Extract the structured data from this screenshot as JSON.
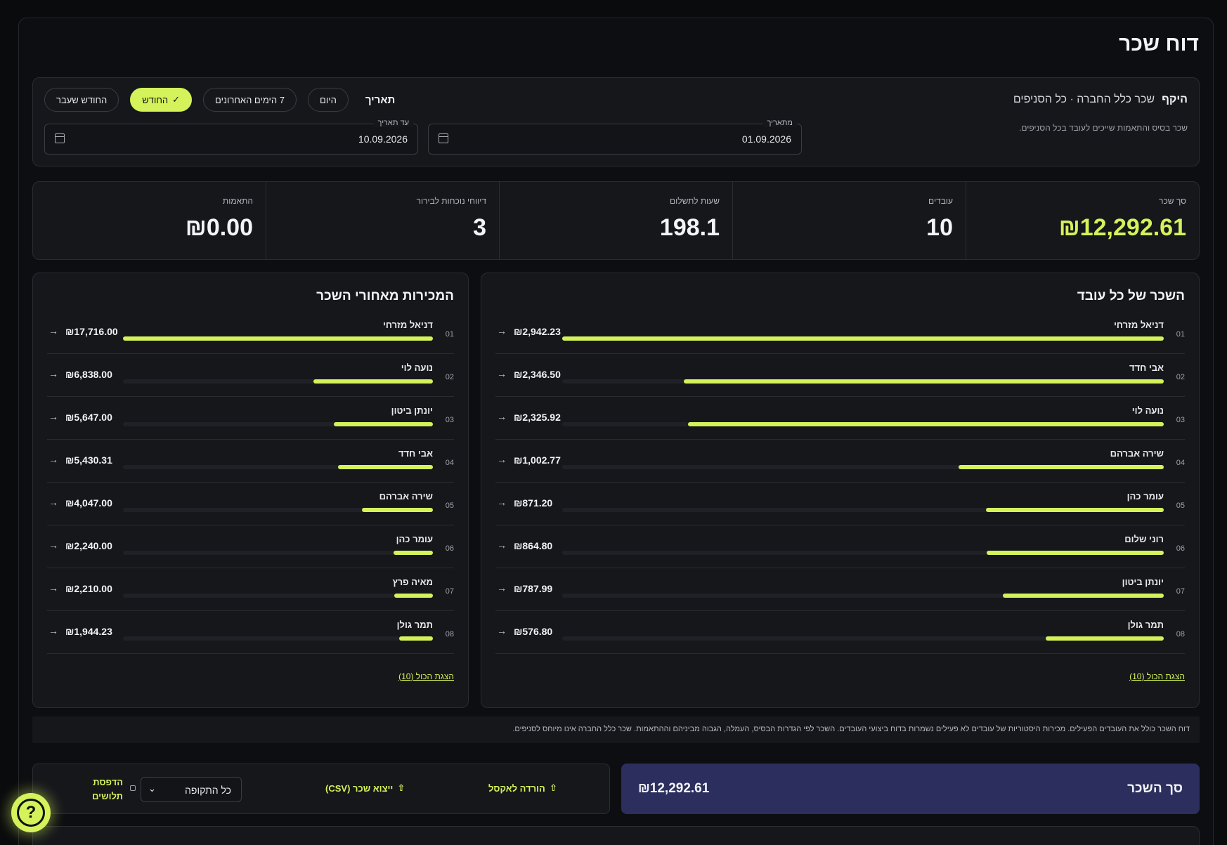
{
  "page": {
    "title": "דוח שכר"
  },
  "filter": {
    "scope_label": "היקף",
    "scope_value": "שכר כלל החברה · כל הסניפים",
    "scope_desc": "שכר בסיס והתאמות שייכים לעובד בכל הסניפים.",
    "date_label": "תאריך",
    "presets": {
      "today": "היום",
      "last7": "7 הימים האחרונים",
      "this_month": "החודש",
      "last_month": "החודש שעבר"
    },
    "from": {
      "legend": "מתאריך",
      "value": "01.09.2026"
    },
    "to": {
      "legend": "עד תאריך",
      "value": "10.09.2026"
    }
  },
  "stats": [
    {
      "label": "סך שכר",
      "value": "₪12,292.61"
    },
    {
      "label": "עובדים",
      "value": "10"
    },
    {
      "label": "שעות לתשלום",
      "value": "198.1"
    },
    {
      "label": "דיווחי נוכחות לבירור",
      "value": "3"
    },
    {
      "label": "התאמות",
      "value": "₪0.00"
    }
  ],
  "employee_pay": {
    "title": "השכר של כל עובד",
    "show_all": "הצגת הכול (10)",
    "rows": [
      {
        "rank": "01",
        "name": "דניאל מזרחי",
        "amount": "₪2,942.23",
        "value": 2942.23
      },
      {
        "rank": "02",
        "name": "אבי חדד",
        "amount": "₪2,346.50",
        "value": 2346.5
      },
      {
        "rank": "03",
        "name": "נועה לוי",
        "amount": "₪2,325.92",
        "value": 2325.92
      },
      {
        "rank": "04",
        "name": "שירה אברהם",
        "amount": "₪1,002.77",
        "value": 1002.77
      },
      {
        "rank": "05",
        "name": "עומר כהן",
        "amount": "₪871.20",
        "value": 871.2
      },
      {
        "rank": "06",
        "name": "רוני שלום",
        "amount": "₪864.80",
        "value": 864.8
      },
      {
        "rank": "07",
        "name": "יונתן ביטון",
        "amount": "₪787.99",
        "value": 787.99
      },
      {
        "rank": "08",
        "name": "תמר גולן",
        "amount": "₪576.80",
        "value": 576.8
      }
    ]
  },
  "sales_behind_pay": {
    "title": "המכירות מאחורי השכר",
    "show_all": "הצגת הכול (10)",
    "rows": [
      {
        "rank": "01",
        "name": "דניאל מזרחי",
        "amount": "₪17,716.00",
        "value": 17716.0
      },
      {
        "rank": "02",
        "name": "נועה לוי",
        "amount": "₪6,838.00",
        "value": 6838.0
      },
      {
        "rank": "03",
        "name": "יונתן ביטון",
        "amount": "₪5,647.00",
        "value": 5647.0
      },
      {
        "rank": "04",
        "name": "אבי חדד",
        "amount": "₪5,430.31",
        "value": 5430.31
      },
      {
        "rank": "05",
        "name": "שירה אברהם",
        "amount": "₪4,047.00",
        "value": 4047.0
      },
      {
        "rank": "06",
        "name": "עומר כהן",
        "amount": "₪2,240.00",
        "value": 2240.0
      },
      {
        "rank": "07",
        "name": "מאיה פרץ",
        "amount": "₪2,210.00",
        "value": 2210.0
      },
      {
        "rank": "08",
        "name": "תמר גולן",
        "amount": "₪1,944.23",
        "value": 1944.23
      }
    ]
  },
  "footnote": "דוח השכר כולל את העובדים הפעילים. מכירות היסטוריות של עובדים לא פעילים נשמרות בדוח ביצועי העובדים. השכר לפי הגדרות הבסיס, העמלה, הגבוה מביניהם וההתאמות. שכר כלל החברה אינו מיוחס לסניפים.",
  "total": {
    "label": "סך השכר",
    "value": "₪12,292.61"
  },
  "actions": {
    "excel": "הורדה לאקסל",
    "csv": "ייצוא שכר (CSV)",
    "period_select": "כל התקופה",
    "print_payslips": "הדפסת תלושים"
  },
  "colors": {
    "accent": "#d4f25a",
    "total_bg": "#2c2f5e",
    "background": "#0a0b0d"
  }
}
